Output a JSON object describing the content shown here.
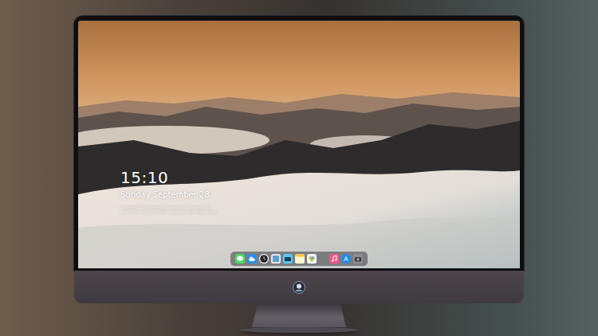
{
  "screen": {
    "time": "15:10",
    "date": "Sunday September 28",
    "tagline": [
      "Innovating technology. Amazing creativity. Fit",
      "your best computer for a smarter life. Rainmeter"
    ]
  }
}
